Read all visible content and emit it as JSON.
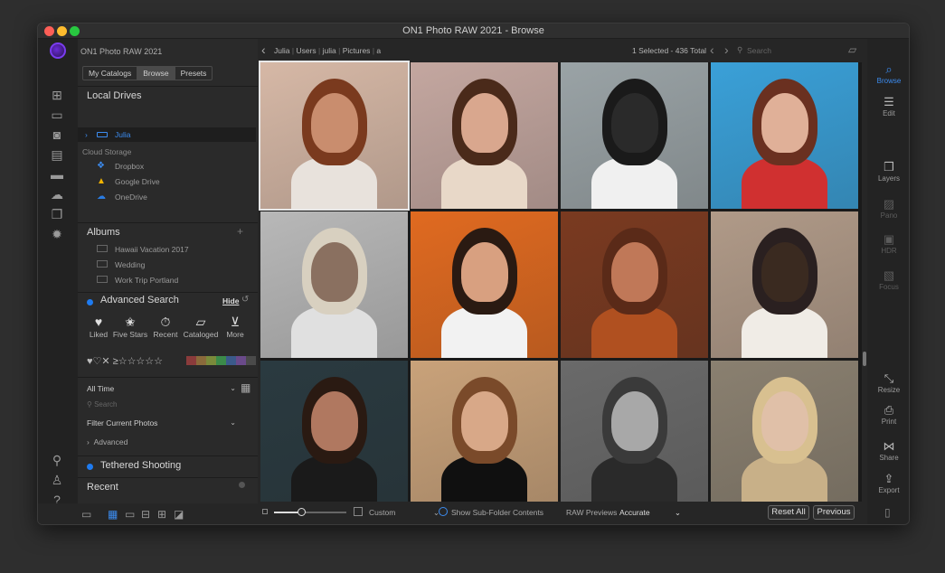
{
  "window": {
    "title": "ON1 Photo RAW 2021 - Browse",
    "app_name": "ON1 Photo RAW 2021"
  },
  "tabs": [
    "My Catalogs",
    "Browse",
    "Presets"
  ],
  "local_drives": {
    "title": "Local Drives",
    "items": [
      {
        "label": "Julia"
      }
    ]
  },
  "cloud": {
    "title": "Cloud Storage",
    "items": [
      {
        "label": "Dropbox"
      },
      {
        "label": "Google Drive"
      },
      {
        "label": "OneDrive"
      }
    ]
  },
  "albums": {
    "title": "Albums",
    "items": [
      "Hawaii Vacation 2017",
      "Wedding",
      "Work Trip Portland"
    ]
  },
  "advanced_search": {
    "title": "Advanced Search",
    "hide_label": "Hide",
    "tiles": [
      {
        "label": "Liked",
        "icon": "heart-icon"
      },
      {
        "label": "Five Stars",
        "icon": "stars-icon"
      },
      {
        "label": "Recent",
        "icon": "stopwatch-icon"
      },
      {
        "label": "Cataloged",
        "icon": "folder-icon"
      },
      {
        "label": "More",
        "icon": "chevron-box-icon"
      }
    ],
    "rating_text": "♥♡✕ ≥☆☆☆☆☆",
    "swatch_colors": [
      "#8a3b3b",
      "#8a6a3b",
      "#7a8a3b",
      "#3b8a4a",
      "#3b5a8a",
      "#6a4a8a",
      "#4a4a4a"
    ],
    "time_filter": "All Time",
    "search_placeholder": "Search",
    "filter_label": "Filter Current Photos",
    "advanced_label": "Advanced"
  },
  "tethered": {
    "title": "Tethered Shooting"
  },
  "recent": {
    "title": "Recent"
  },
  "breadcrumb": [
    "Julia",
    "Users",
    "julia",
    "Pictures",
    "a"
  ],
  "selection_status": "1 Selected - 436 Total",
  "search_placeholder": "Search",
  "right_modules": [
    {
      "label": "Browse",
      "icon": "browse-icon",
      "state": "active"
    },
    {
      "label": "Edit",
      "icon": "sliders-icon",
      "state": "normal"
    },
    {
      "label": "Layers",
      "icon": "layers-icon",
      "state": "normal"
    },
    {
      "label": "Pano",
      "icon": "pano-icon",
      "state": "dim"
    },
    {
      "label": "HDR",
      "icon": "hdr-icon",
      "state": "dim"
    },
    {
      "label": "Focus",
      "icon": "focus-icon",
      "state": "dim"
    },
    {
      "label": "Resize",
      "icon": "resize-icon",
      "state": "normal"
    },
    {
      "label": "Print",
      "icon": "printer-icon",
      "state": "normal"
    },
    {
      "label": "Share",
      "icon": "share-icon",
      "state": "normal"
    },
    {
      "label": "Export",
      "icon": "export-icon",
      "state": "normal"
    }
  ],
  "bottom": {
    "size_label": "Custom",
    "subfolder_label": "Show Sub-Folder Contents",
    "raw_previews_label": "RAW Previews",
    "raw_previews_value": "Accurate",
    "reset_label": "Reset All",
    "previous_label": "Previous"
  },
  "photos": [
    {
      "bg": "#d6b8a6",
      "skin": "#c98d6e",
      "hair": "#7a3a1e",
      "cloth": "#e8e2dc"
    },
    {
      "bg": "#c4a7a0",
      "skin": "#d9a78e",
      "hair": "#4a2a1a",
      "cloth": "#e8d8c8"
    },
    {
      "bg": "#9aa3a6",
      "skin": "#2a2a2a",
      "hair": "#1a1a1a",
      "cloth": "#f0f0f0"
    },
    {
      "bg": "#3aa0d8",
      "skin": "#e0b098",
      "hair": "#6a3020",
      "cloth": "#d03030"
    },
    {
      "bg": "#b8b8b8",
      "skin": "#8a7060",
      "hair": "#d8d0c0",
      "cloth": "#e0e0e0"
    },
    {
      "bg": "#e06a20",
      "skin": "#d8a080",
      "hair": "#2a1a12",
      "cloth": "#f2f2f2"
    },
    {
      "bg": "#7a3a20",
      "skin": "#c07858",
      "hair": "#5a2a18",
      "cloth": "#b05020"
    },
    {
      "bg": "#b09a88",
      "skin": "#3a2a20",
      "hair": "#2a2020",
      "cloth": "#f0ece6"
    },
    {
      "bg": "#2a3a40",
      "skin": "#b07860",
      "hair": "#2a1a12",
      "cloth": "#1a1a1a"
    },
    {
      "bg": "#c9a27a",
      "skin": "#d8a888",
      "hair": "#7a4a2a",
      "cloth": "#101010"
    },
    {
      "bg": "#6a6a6a",
      "skin": "#a8a8a8",
      "hair": "#3a3a3a",
      "cloth": "#2a2a2a"
    },
    {
      "bg": "#8a8070",
      "skin": "#e0c0a8",
      "hair": "#d8c090",
      "cloth": "#c8b088"
    }
  ]
}
